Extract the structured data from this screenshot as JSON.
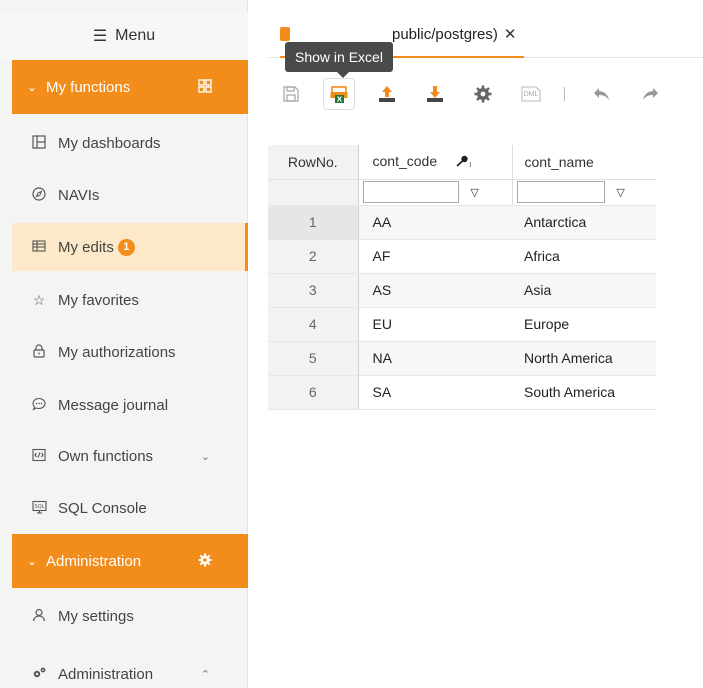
{
  "sidebar": {
    "menu_label": "Menu",
    "my_functions_label": "My functions",
    "administration_section_label": "Administration",
    "items": [
      {
        "label": "My dashboards",
        "icon": "dashboard-icon"
      },
      {
        "label": "NAVIs",
        "icon": "compass-icon"
      },
      {
        "label": "My edits",
        "icon": "table-edit-icon",
        "badge": "1",
        "active": true
      },
      {
        "label": "My favorites",
        "icon": "star-icon"
      },
      {
        "label": "My authorizations",
        "icon": "lock-icon"
      },
      {
        "label": "Message journal",
        "icon": "chat-icon"
      },
      {
        "label": "Own functions",
        "icon": "code-icon"
      },
      {
        "label": "SQL Console",
        "icon": "sql-console-icon"
      }
    ],
    "admin_items": [
      {
        "label": "My settings",
        "icon": "user-icon"
      },
      {
        "label": "Administration",
        "icon": "admin-gears-icon"
      }
    ]
  },
  "tab": {
    "label": "public/postgres)",
    "close": "✕"
  },
  "tooltip": "Show in Excel",
  "toolbar": {
    "dml_label": "DML"
  },
  "grid": {
    "columns": [
      "RowNo.",
      "cont_code",
      "cont_name"
    ],
    "rows": [
      [
        "1",
        "AA",
        "Antarctica"
      ],
      [
        "2",
        "AF",
        "Africa"
      ],
      [
        "3",
        "AS",
        "Asia"
      ],
      [
        "4",
        "EU",
        "Europe"
      ],
      [
        "5",
        "NA",
        "North America"
      ],
      [
        "6",
        "SA",
        "South America"
      ]
    ]
  },
  "colors": {
    "accent": "#f28c1b",
    "active_bg": "#fde9c9",
    "excel_green": "#1e7a3a"
  }
}
